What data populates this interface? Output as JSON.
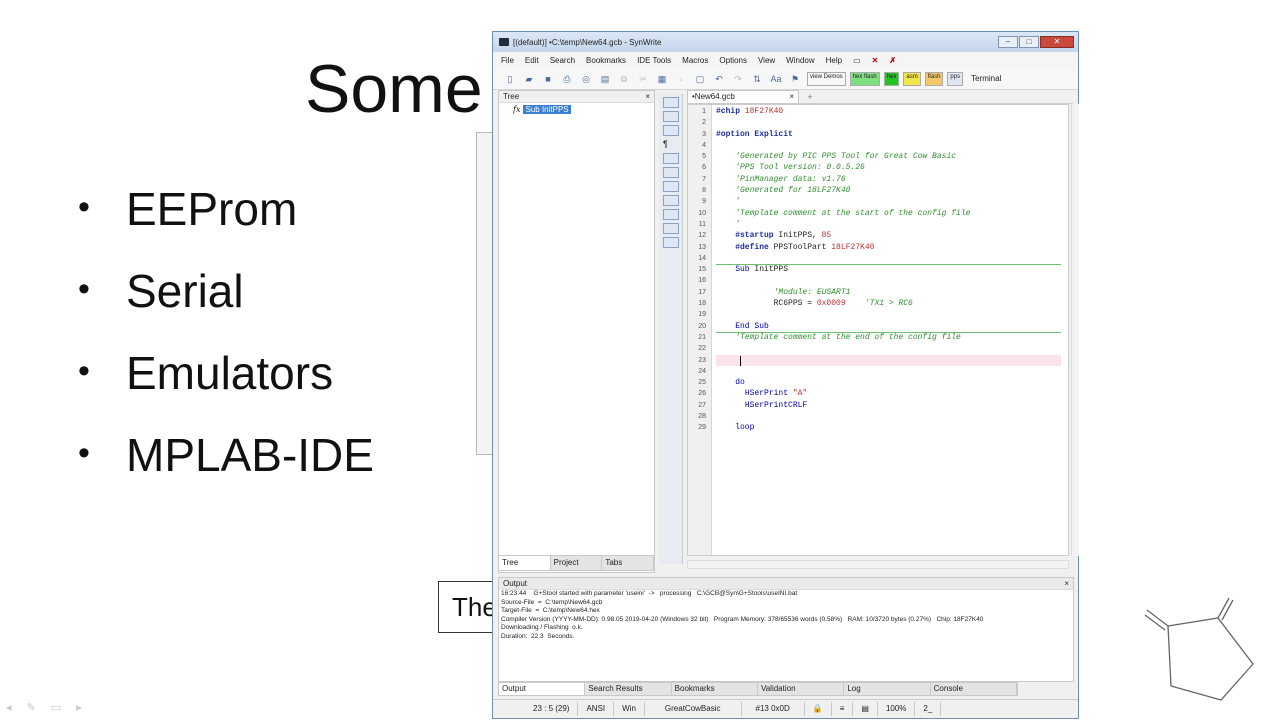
{
  "slide": {
    "title": "Some",
    "bullets": [
      "EEProm",
      "Serial",
      "Emulators",
      "MPLAB-IDE"
    ],
    "box_text": "The"
  },
  "window": {
    "title": "[(default)] •C:\\temp\\New64.gcb - SynWrite",
    "minimize": "–",
    "maximize": "□",
    "close": "✕"
  },
  "menu": [
    "File",
    "Edit",
    "Search",
    "Bookmarks",
    "IDE Tools",
    "Macros",
    "Options",
    "View",
    "Window",
    "Help"
  ],
  "toolbar": {
    "badges": [
      "view Demos",
      "hex flash",
      "hex",
      "asm",
      "flash",
      "pps"
    ],
    "terminal": "Terminal"
  },
  "tree": {
    "header": "Tree",
    "close": "×",
    "item_prefix": "fx",
    "item": "Sub InitPPS",
    "tabs": [
      "Tree",
      "Project",
      "Tabs"
    ]
  },
  "editor": {
    "tab": "•New64.gcb",
    "tab_close": "×",
    "tab_add": "+",
    "lines": [
      {
        "n": "1",
        "parts": [
          [
            "kw",
            "#chip "
          ],
          [
            "nm",
            "18F27K40"
          ]
        ]
      },
      {
        "n": "2",
        "parts": []
      },
      {
        "n": "3",
        "parts": [
          [
            "kw",
            "#option Explicit"
          ]
        ]
      },
      {
        "n": "4",
        "parts": []
      },
      {
        "n": "5",
        "parts": [
          [
            "pl",
            "    "
          ],
          [
            "cm",
            "'Generated by PIC PPS Tool for Great Cow Basic"
          ]
        ]
      },
      {
        "n": "6",
        "parts": [
          [
            "pl",
            "    "
          ],
          [
            "cm",
            "'PPS Tool version: 0.0.5.26"
          ]
        ]
      },
      {
        "n": "7",
        "parts": [
          [
            "pl",
            "    "
          ],
          [
            "cm",
            "'PinManager data: v1.76"
          ]
        ]
      },
      {
        "n": "8",
        "parts": [
          [
            "pl",
            "    "
          ],
          [
            "cm",
            "'Generated for 18LF27K40"
          ]
        ]
      },
      {
        "n": "9",
        "parts": [
          [
            "pl",
            "    "
          ],
          [
            "cm",
            "'"
          ]
        ]
      },
      {
        "n": "10",
        "parts": [
          [
            "pl",
            "    "
          ],
          [
            "cm",
            "'Template comment at the start of the config file"
          ]
        ]
      },
      {
        "n": "11",
        "parts": [
          [
            "pl",
            "    "
          ],
          [
            "cm",
            "'"
          ]
        ]
      },
      {
        "n": "12",
        "parts": [
          [
            "pl",
            "    "
          ],
          [
            "kw",
            "#startup"
          ],
          [
            "pl",
            " InitPPS, "
          ],
          [
            "nm",
            "85"
          ]
        ]
      },
      {
        "n": "13",
        "parts": [
          [
            "pl",
            "    "
          ],
          [
            "kw",
            "#define"
          ],
          [
            "pl",
            " PPSToolPart "
          ],
          [
            "nm",
            "18LF27K40"
          ]
        ]
      },
      {
        "n": "14",
        "parts": []
      },
      {
        "n": "15",
        "parts": [
          [
            "pl",
            "    "
          ],
          [
            "tx",
            "Sub"
          ],
          [
            "pl",
            " InitPPS"
          ]
        ]
      },
      {
        "n": "16",
        "parts": []
      },
      {
        "n": "17",
        "parts": [
          [
            "pl",
            "            "
          ],
          [
            "cm",
            "'Module: EUSART1"
          ]
        ]
      },
      {
        "n": "18",
        "parts": [
          [
            "pl",
            "            RC6PPS = "
          ],
          [
            "nm",
            "0x0009"
          ],
          [
            "pl",
            "    "
          ],
          [
            "cm",
            "'TX1 > RC6"
          ]
        ]
      },
      {
        "n": "19",
        "parts": []
      },
      {
        "n": "20",
        "parts": [
          [
            "pl",
            "    "
          ],
          [
            "tx",
            "End Sub"
          ]
        ]
      },
      {
        "n": "21",
        "parts": [
          [
            "pl",
            "    "
          ],
          [
            "cm",
            "'Template comment at the end of the config file"
          ]
        ]
      },
      {
        "n": "22",
        "parts": []
      },
      {
        "n": "23",
        "parts": []
      },
      {
        "n": "24",
        "parts": []
      },
      {
        "n": "25",
        "parts": [
          [
            "pl",
            "    "
          ],
          [
            "tx",
            "do"
          ]
        ]
      },
      {
        "n": "26",
        "parts": [
          [
            "pl",
            "      "
          ],
          [
            "tx",
            "HSerPrint "
          ],
          [
            "nm",
            "\"A\""
          ]
        ]
      },
      {
        "n": "27",
        "parts": [
          [
            "pl",
            "      "
          ],
          [
            "tx",
            "HSerPrintCRLF"
          ]
        ]
      },
      {
        "n": "28",
        "parts": []
      },
      {
        "n": "29",
        "parts": [
          [
            "pl",
            "    "
          ],
          [
            "tx",
            "loop"
          ]
        ]
      }
    ]
  },
  "output": {
    "header": "Output",
    "close": "×",
    "lines": [
      "16:23:44    G+Stool started with parameter 'useini'  ->   processing   C:\\GCB@Syn\\G+Stools\\useINI.bat",
      "Source-File  =  C:\\temp\\New64.gcb",
      "Target-File  =  C:\\temp\\New64.hex",
      "Compiler Version (YYYY-MM-DD): 0.98.05 2019-04-20 (Windows 32 bit)   Program Memory: 378/65536 words (0.58%)   RAM: 10/3720 bytes (0.27%)   Chip: 18F27K40",
      "Downloading / Flashing  o.k.",
      "Duration:  22.3  Seconds."
    ],
    "tabs": [
      "Output",
      "Search Results",
      "Bookmarks",
      "Validation",
      "Log",
      "Console"
    ]
  },
  "status": {
    "position": "23 : 5 (29)",
    "encoding": "ANSI",
    "eol": "Win",
    "lexer": "GreatCowBasic",
    "char": "#13 0x0D",
    "zoom": "100%",
    "extra": "2_"
  }
}
